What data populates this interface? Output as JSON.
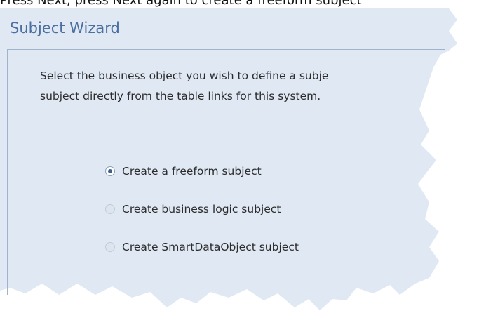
{
  "caption": "Press Next, press Next again to create a freeform subject",
  "wizard": {
    "title": "Subject Wizard",
    "instructions": [
      "Select the business object you wish to define a subje",
      "subject directly from the table links for this system."
    ],
    "options": [
      {
        "label": "Create a freeform subject",
        "selected": true
      },
      {
        "label": "Create business logic subject",
        "selected": false
      },
      {
        "label": "Create SmartDataObject subject",
        "selected": false
      }
    ]
  },
  "colors": {
    "panel_bg": "#dfe8f3",
    "title": "#4a6fa0",
    "border": "#9fb3cc"
  }
}
